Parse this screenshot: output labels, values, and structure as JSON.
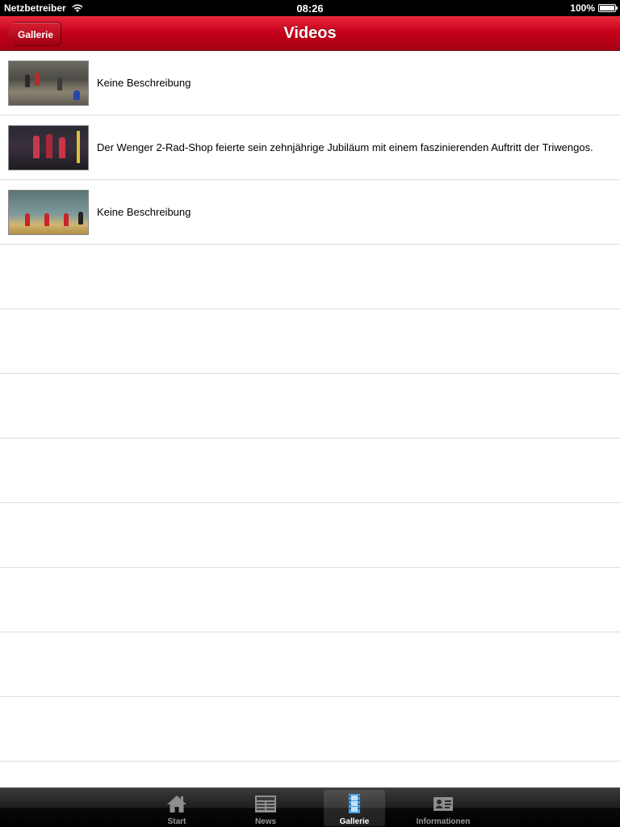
{
  "status_bar": {
    "carrier": "Netzbetreiber",
    "time": "08:26",
    "battery_text": "100%",
    "battery_level": 1.0
  },
  "nav": {
    "back_label": "Gallerie",
    "title": "Videos"
  },
  "videos": [
    {
      "description": "Keine Beschreibung",
      "thumbnail_icon": "video-thumbnail-icon"
    },
    {
      "description": "Der Wenger 2-Rad-Shop feierte sein zehnjährige Jubiläum mit einem faszinierenden Auftritt der Triwengos.",
      "thumbnail_icon": "video-thumbnail-icon"
    },
    {
      "description": "Keine Beschreibung",
      "thumbnail_icon": "video-thumbnail-icon"
    }
  ],
  "tabs": [
    {
      "label": "Start",
      "icon": "home-icon",
      "selected": false
    },
    {
      "label": "News",
      "icon": "newspaper-icon",
      "selected": false
    },
    {
      "label": "Gallerie",
      "icon": "film-icon",
      "selected": true
    },
    {
      "label": "Informationen",
      "icon": "contact-card-icon",
      "selected": false
    }
  ],
  "colors": {
    "nav_red": "#c4001a",
    "tab_selected_blue": "#4aa3e8"
  }
}
